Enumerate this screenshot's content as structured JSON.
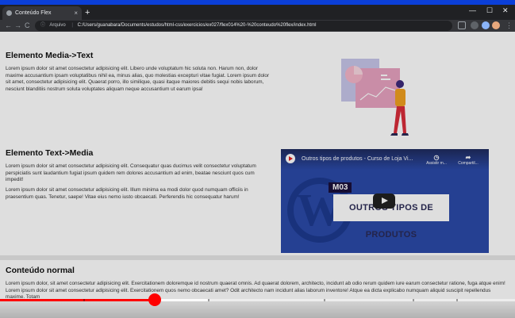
{
  "browser": {
    "tab_title": "Conteúdo Flex",
    "tab_close": "×",
    "new_tab": "+",
    "window_controls": {
      "minimize": "—",
      "maximize": "☐",
      "close": "✕"
    },
    "nav": {
      "back": "←",
      "forward": "→",
      "reload": "C"
    },
    "address_chip": "Arquivo",
    "url": "C:/Users/guanabara/Documents/estudos/html-css/exercicios/ex027/flex014%20-%20conteudo%20flex/index.html"
  },
  "sections": {
    "media_text": {
      "heading": "Elemento Media->Text",
      "paragraph": "Lorem ipsum dolor sit amet consectetur adipisicing elit. Libero unde voluptatum hic soluta non. Harum non, dolor maxime accusantium ipsam voluptatibus nihil ea, minus alias, quo molestias excepturi vitae fugiat. Lorem ipsum dolor sit amet, consectetur adipisicing elit. Quaerat porro, illo similique, quasi itaque maiores debitis sequi nobis laborum, nesciunt blanditiis nostrum soluta voluptates aliquam neque accusantium ut earum ipsa!"
    },
    "text_media": {
      "heading": "Elemento Text->Media",
      "paragraph1": "Lorem ipsum dolor sit amet consectetur adipisicing elit. Consequatur quas ducimus velit consectetur voluptatum perspiciatis sunt laudantium fugiat ipsum quidem rem dolores accusantium ad enim, beatae nesciunt quos cum impedit!",
      "paragraph2": "Lorem ipsum dolor sit amet consectetur adipisicing elit. Illum minima ea modi dolor quod numquam officiis in praesentium quas. Tenetur, saepe! Vitae eius nemo iusto obcaecati. Perferendis hic consequatur harum!"
    },
    "normal": {
      "heading": "Conteúdo normal",
      "paragraph": "Lorem ipsum dolor, sit amet consectetur adipisicing elit. Exercitationem doloremque id nostrum quaerat omnis. Ad quaerat dolorem, architecto, incidunt ab odio rerum quidem iure earum consectetur ratione, fuga atque enim! Lorem ipsum dolor sit amet consectetur adipisicing elit. Exercitationem quos nemo obcaecati amet? Odit architecto nam incidunt alias laborum inventore! Atque ea dicta explicabo numquam aliquid suscipit repellendus maxime. Totam"
    }
  },
  "video": {
    "title": "Outros tipos de produtos - Curso de Loja Vi...",
    "watch_later": "Assistir m...",
    "share": "Compartil...",
    "badge": "M03",
    "banner": "OUTROS TIPOS DE PRODUTOS",
    "wordpress_letter": "W"
  },
  "player": {
    "progress": 0.3
  },
  "colors": {
    "accent_red": "#ff0000",
    "page_blue": "#0b3fd8"
  }
}
